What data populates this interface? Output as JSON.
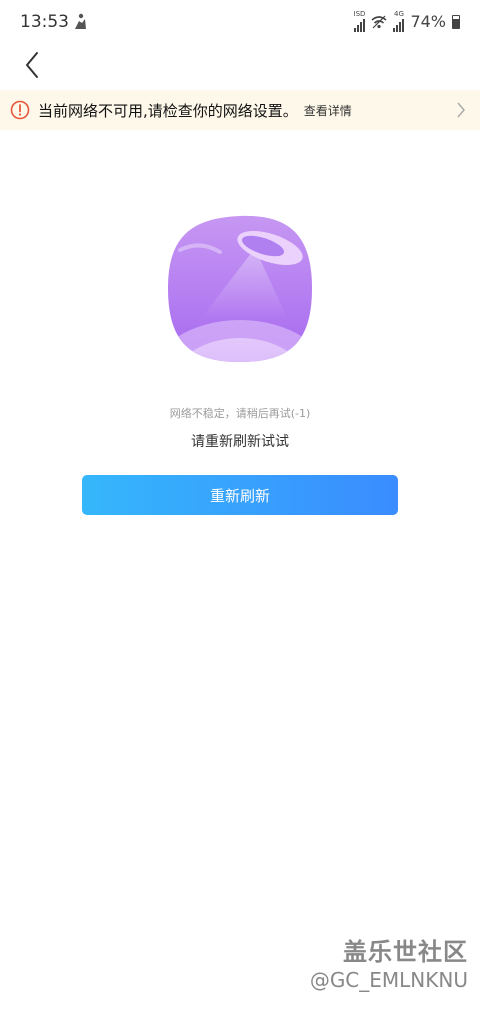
{
  "status_bar": {
    "time": "13:53",
    "sim1_label": "ISD",
    "sim2_label": "4G",
    "battery": "74%"
  },
  "banner": {
    "message": "当前网络不可用,请检查你的网络设置。",
    "link": "查看详情",
    "background": "#fdf8ea",
    "icon_color": "#e8573b"
  },
  "error": {
    "detail": "网络不稳定，请稍后再试(-1)",
    "retry_hint": "请重新刷新试试"
  },
  "refresh_button": {
    "label": "重新刷新",
    "color_start": "#35b7fb",
    "color_end": "#3a8cff"
  },
  "watermark": {
    "title": "盖乐世社区",
    "user": "@GC_EMLNKNU"
  },
  "icons": [
    "back-arrow-icon",
    "warning-circle-icon",
    "chevron-right-icon",
    "wifi-icon",
    "battery-icon"
  ]
}
